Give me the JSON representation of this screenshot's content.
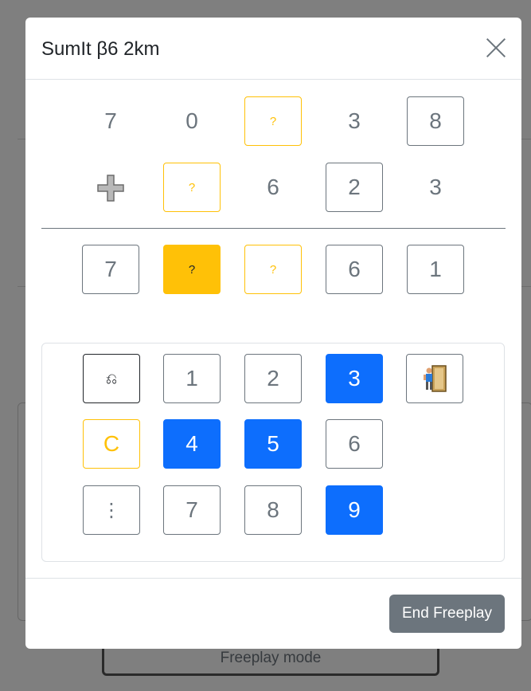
{
  "background": {
    "freeplay_button_label": "Freeplay mode"
  },
  "modal": {
    "title": "SumIt β6 2km",
    "close_icon": "close-icon",
    "addend1": [
      "7",
      "0",
      "?",
      "3",
      "8"
    ],
    "operator_icon": "plus-icon",
    "addend2": [
      "?",
      "6",
      "2",
      "3"
    ],
    "result": [
      "7",
      "?",
      "?",
      "6",
      "1"
    ],
    "keypad": {
      "row1": [
        "⎌",
        "1",
        "2",
        "3",
        "door-exit-icon"
      ],
      "row2": [
        "C",
        "4",
        "5",
        "6"
      ],
      "row3": [
        "⋮",
        "7",
        "8",
        "9"
      ],
      "highlighted_digits": [
        "3",
        "4",
        "5",
        "9"
      ]
    },
    "end_button_label": "End Freeplay"
  },
  "colors": {
    "accent_blue": "#0d6efd",
    "warning_yellow": "#ffc107",
    "secondary_gray": "#6c757d"
  }
}
